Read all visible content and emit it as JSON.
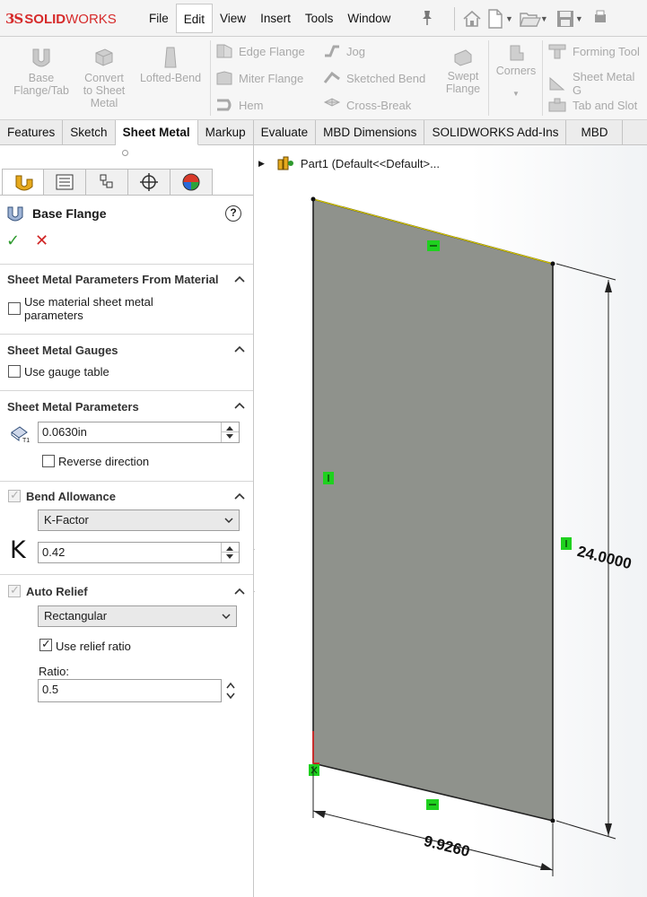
{
  "app": {
    "logo_prefix": "3S",
    "logo_solid": "SOLID",
    "logo_works": "WORKS"
  },
  "menu": [
    "File",
    "Edit",
    "View",
    "Insert",
    "Tools",
    "Window"
  ],
  "menu_active": "Edit",
  "ribbon": {
    "base_flange": [
      "Base",
      "Flange/Tab"
    ],
    "convert": [
      "Convert",
      "to Sheet",
      "Metal"
    ],
    "lofted_bend": "Lofted-Bend",
    "edge_flange": "Edge Flange",
    "miter_flange": "Miter Flange",
    "hem": "Hem",
    "jog": "Jog",
    "sketched_bend": "Sketched Bend",
    "cross_break": "Cross-Break",
    "swept_flange": [
      "Swept",
      "Flange"
    ],
    "corners": "Corners",
    "forming_tool": "Forming Tool",
    "sheet_metal_gusset": "Sheet Metal G",
    "tab_and_slot": "Tab and Slot"
  },
  "tabs": [
    "Features",
    "Sketch",
    "Sheet Metal",
    "Markup",
    "Evaluate",
    "MBD Dimensions",
    "SOLIDWORKS Add-Ins",
    "MBD"
  ],
  "tab_active": "Sheet Metal",
  "property_manager": {
    "title": "Base Flange",
    "help": "?",
    "ok": "✓",
    "cancel": "✕",
    "from_material": {
      "title": "Sheet Metal Parameters From Material",
      "use_material_label_1": "Use material sheet metal",
      "use_material_label_2": "parameters",
      "use_material_checked": false
    },
    "gauges": {
      "title": "Sheet Metal Gauges",
      "use_gauge_label": "Use gauge table",
      "use_gauge_checked": false
    },
    "parameters": {
      "title": "Sheet Metal Parameters",
      "thickness": "0.0630in",
      "reverse_label": "Reverse direction",
      "reverse_checked": false
    },
    "bend_allowance": {
      "title": "Bend Allowance",
      "checked": true,
      "type": "K-Factor",
      "k_symbol": "K",
      "k_value": "0.42"
    },
    "auto_relief": {
      "title": "Auto Relief",
      "checked": true,
      "type": "Rectangular",
      "use_ratio_label": "Use relief ratio",
      "use_ratio_checked": true,
      "ratio_label": "Ratio:",
      "ratio_value": "0.5"
    }
  },
  "tree": {
    "part_label": "Part1  (Default<<Default>..."
  },
  "dimensions": {
    "height": "24.0000",
    "width": "9.9260"
  },
  "colors": {
    "sheet_fill": "#8f928c",
    "relation_green": "#1fd11f",
    "brand_red": "#d62a2a",
    "ok_green": "#2e9a2e",
    "cancel_red": "#d02424"
  }
}
